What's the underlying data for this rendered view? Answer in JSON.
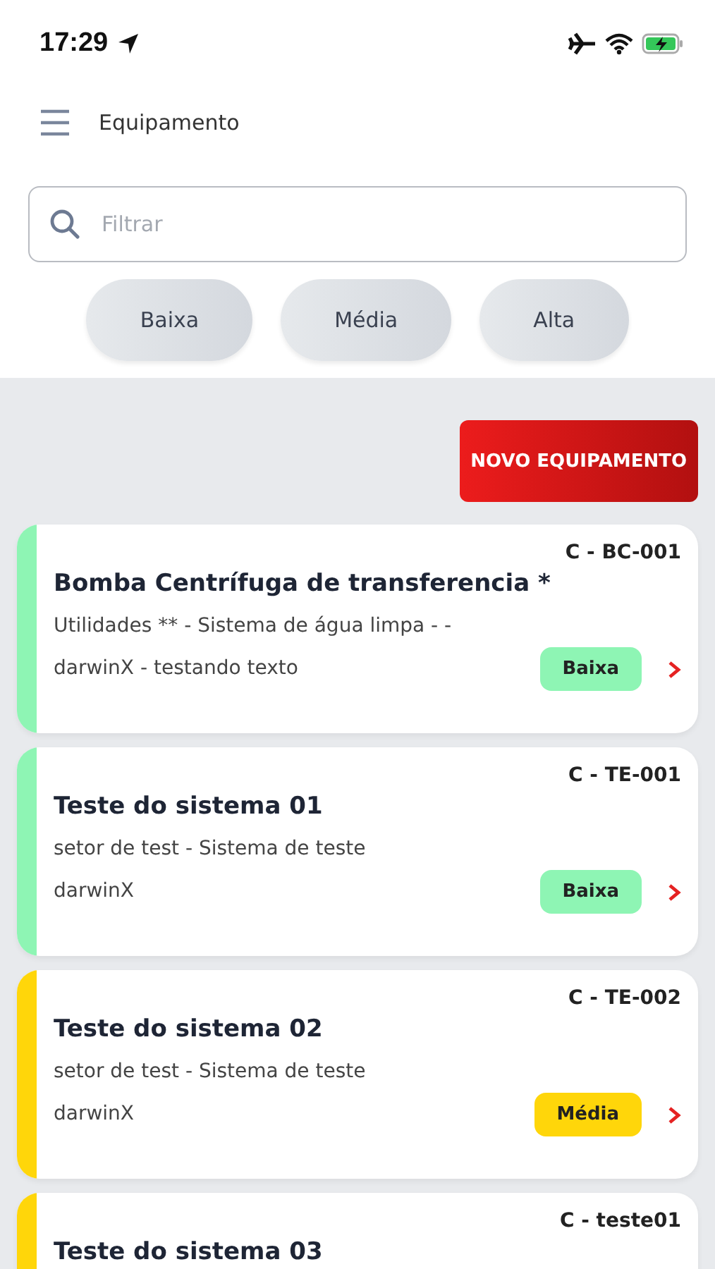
{
  "status_bar": {
    "time": "17:29"
  },
  "header": {
    "title": "Equipamento"
  },
  "search": {
    "placeholder": "Filtrar"
  },
  "filters": [
    {
      "label": "Baixa"
    },
    {
      "label": "Média"
    },
    {
      "label": "Alta"
    }
  ],
  "new_button": "NOVO EQUIPAMENTO",
  "equipment": [
    {
      "code": "C - BC-001",
      "name": "Bomba Centrífuga de transferencia *",
      "details": "Utilidades **  - Sistema de água limpa - -",
      "owner": "darwinX - testando texto",
      "priority": "Baixa",
      "color": "#8ef5b4"
    },
    {
      "code": "C - TE-001",
      "name": "Teste do sistema 01",
      "details": "setor de test  - Sistema de teste",
      "owner": "darwinX",
      "priority": "Baixa",
      "color": "#8ef5b4"
    },
    {
      "code": "C - TE-002",
      "name": "Teste do sistema 02",
      "details": "setor de test  - Sistema de teste",
      "owner": "darwinX",
      "priority": "Média",
      "color": "#ffd60a"
    },
    {
      "code": "C - teste01",
      "name": "Teste do sistema 03",
      "color": "#ffd60a"
    }
  ]
}
